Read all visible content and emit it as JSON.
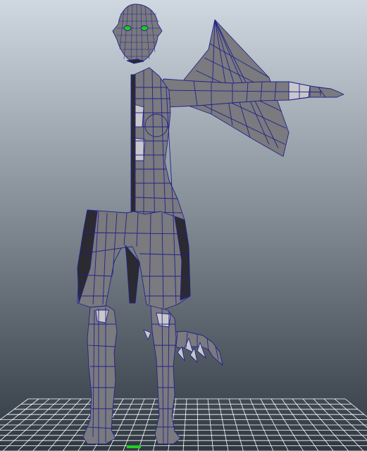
{
  "viewport": {
    "background_top": "#cfd8e1",
    "background_bottom": "#2f3841",
    "grid_color": "#ffffff",
    "mesh_fill": "#7a7a7f",
    "mesh_fill_dark": "#2a2a30",
    "mesh_fill_light": "#c8c8cc",
    "wire_color": "#22228a",
    "eye_color": "#26c226",
    "axis_color": "#1fd11f"
  }
}
